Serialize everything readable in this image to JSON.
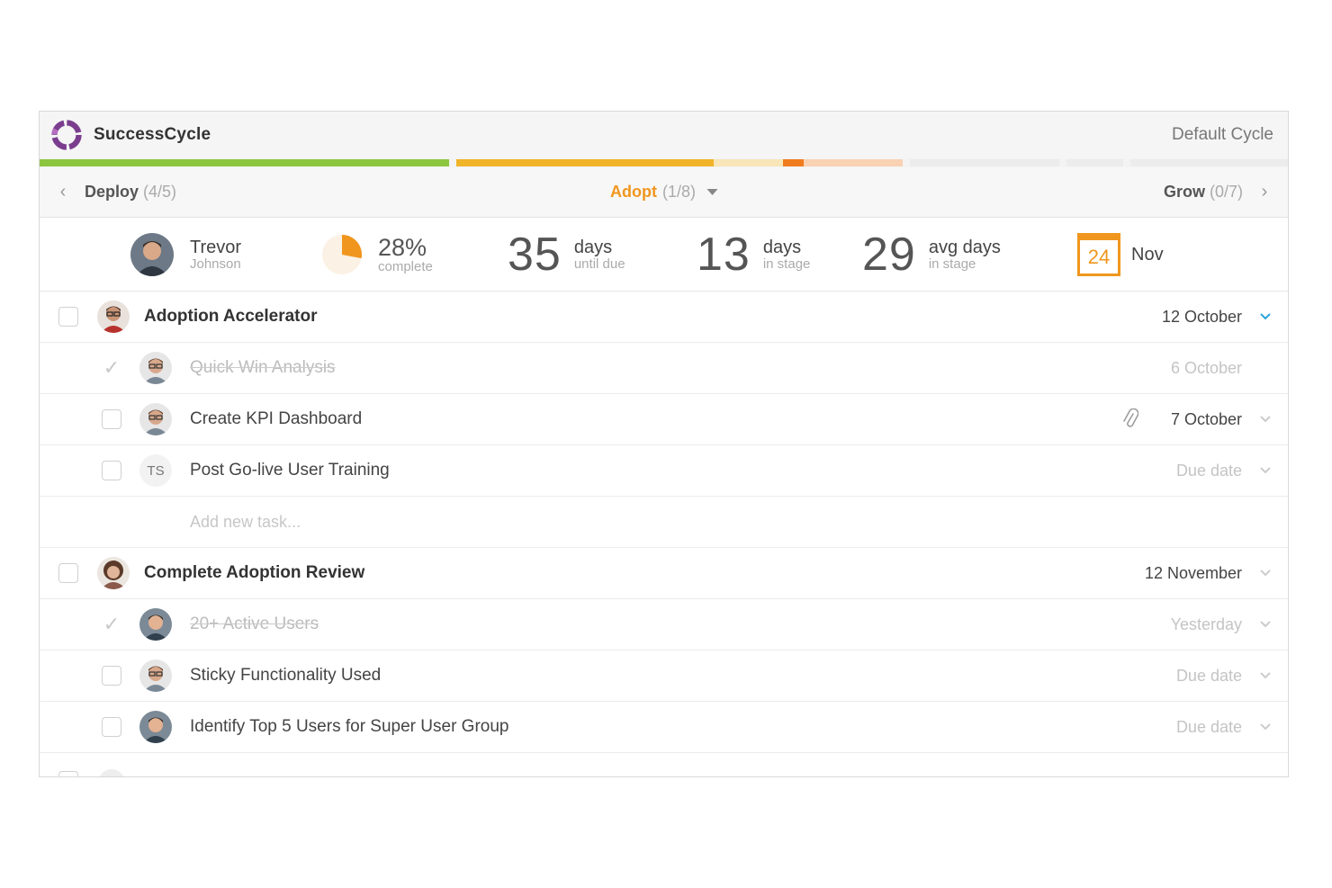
{
  "app": {
    "name": "SuccessCycle",
    "logo_icon": "successcycle-logo",
    "brand_color": "#7b3e8e"
  },
  "cycle": {
    "name": "Default Cycle"
  },
  "progress_segments": [
    {
      "color": "#8cc63f",
      "fraction": 0.328
    },
    {
      "color": "#f0b428",
      "fraction": 0.206
    },
    {
      "color": "#f8e5b8",
      "fraction": 0.056
    },
    {
      "color": "#f07c1e",
      "fraction": 0.016
    },
    {
      "color": "#f9d2b4",
      "fraction": 0.08
    },
    {
      "color": "#ececec",
      "fraction": 0.119
    },
    {
      "color": "#ececec",
      "fraction": 0.046
    },
    {
      "color": "#ececec",
      "fraction": 0.13
    }
  ],
  "stages": {
    "prev": {
      "name": "Deploy",
      "count": "(4/5)"
    },
    "current": {
      "name": "Adopt",
      "count": "(1/8)",
      "color": "#f0961e"
    },
    "next": {
      "name": "Grow",
      "count": "(0/7)"
    }
  },
  "stats": {
    "owner": {
      "first": "Trevor",
      "last": "Johnson"
    },
    "complete": {
      "value": "28%",
      "label": "complete",
      "fraction": 0.28,
      "color": "#f0961e"
    },
    "until_due": {
      "value": "35",
      "label_a": "days",
      "label_b": "until due"
    },
    "in_stage": {
      "value": "13",
      "label_a": "days",
      "label_b": "in stage"
    },
    "avg_in_stage": {
      "value": "29",
      "label_a": "avg days",
      "label_b": "in stage"
    },
    "due": {
      "day": "24",
      "month": "Nov"
    }
  },
  "groups": [
    {
      "title": "Adoption Accelerator",
      "date": "12 October",
      "avatar": "man-glasses",
      "chevron_color": "#2aa4d8",
      "tasks": [
        {
          "title": "Quick Win Analysis",
          "date": "6 October",
          "done": true,
          "avatar": "man-glasses-2",
          "date_muted": true,
          "chevron": false
        },
        {
          "title": "Create KPI Dashboard",
          "date": "7 October",
          "done": false,
          "avatar": "man-glasses-2",
          "attachment": true,
          "date_muted": false,
          "chevron": true
        },
        {
          "title": "Post Go-live User Training",
          "date": "Due date",
          "done": false,
          "initials": "TS",
          "date_muted": true,
          "chevron": true
        }
      ],
      "add_task_placeholder": "Add new task..."
    },
    {
      "title": "Complete Adoption Review",
      "date": "12 November",
      "avatar": "woman-curly",
      "chevron_color": "#cccccc",
      "tasks": [
        {
          "title": "20+ Active Users",
          "date": "Yesterday",
          "done": true,
          "avatar": "man-smile",
          "date_muted": true,
          "chevron": true
        },
        {
          "title": "Sticky Functionality Used",
          "date": "Due date",
          "done": false,
          "avatar": "man-glasses-2",
          "date_muted": true,
          "chevron": true
        },
        {
          "title": "Identify Top 5 Users for Super User Group",
          "date": "Due date",
          "done": false,
          "avatar": "man-smile",
          "date_muted": true,
          "chevron": true
        }
      ]
    }
  ]
}
